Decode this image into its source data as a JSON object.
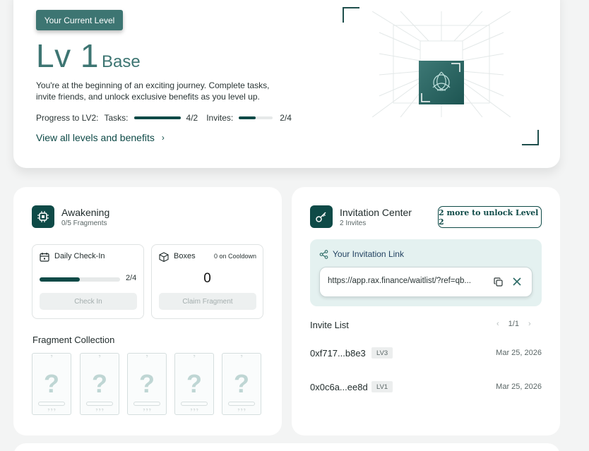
{
  "level": {
    "badge": "Your Current Level",
    "title": "Lv 1",
    "subtitle": "Base",
    "description": "You're at the beginning of an exciting journey. Complete tasks, invite friends, and unlock exclusive benefits as you level up.",
    "progress_label": "Progress to LV2:",
    "tasks_label": "Tasks:",
    "tasks_value": "4/2",
    "tasks_fraction": 1.0,
    "invites_label": "Invites:",
    "invites_value": "2/4",
    "invites_fraction": 0.5,
    "view_link": "View all levels and benefits"
  },
  "awakening": {
    "title": "Awakening",
    "subtitle": "0/5 Fragments",
    "checkin": {
      "title": "Daily Check-In",
      "value": "2/4",
      "fraction": 0.5,
      "button": "Check In"
    },
    "boxes": {
      "title": "Boxes",
      "cooldown": "0 on Cooldown",
      "count": "0",
      "button": "Claim Fragment"
    },
    "fragments_title": "Fragment Collection",
    "fragment_mark": "?"
  },
  "invitation": {
    "title": "Invitation Center",
    "subtitle": "2 Invites",
    "unlock_button": "2 more to unlock Level 2",
    "link_label": "Your Invitation Link",
    "link_value": "https://app.rax.finance/waitlist/?ref=qb...",
    "list_title": "Invite List",
    "page": "1/1",
    "invites": [
      {
        "address": "0xf717...b8e3",
        "level": "LV3",
        "date": "Mar 25, 2026"
      },
      {
        "address": "0x0c6a...ee8d",
        "level": "LV1",
        "date": "Mar 25, 2026"
      }
    ]
  },
  "colors": {
    "accent": "#0e4a47",
    "accent_light": "#3d7572",
    "panel": "#e4f1f0"
  }
}
